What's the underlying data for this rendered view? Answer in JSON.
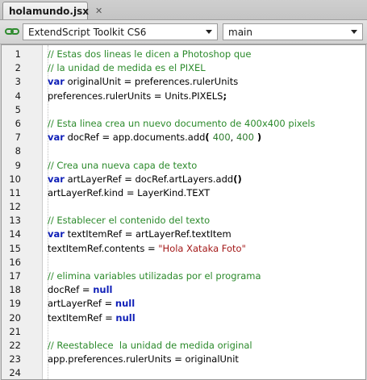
{
  "tab": {
    "title": "holamundo.jsx",
    "close_symbol": "✕"
  },
  "toolbar": {
    "target_app": "ExtendScript Toolkit CS6",
    "engine": "main",
    "link_icon": "link-chain-icon"
  },
  "colors": {
    "comment": "#2b8a2b",
    "keyword": "#1020b8",
    "string": "#a31818",
    "number": "#2c7a2c"
  },
  "editor": {
    "lines": [
      {
        "n": "1",
        "tokens": [
          {
            "t": "// Estas dos lineas le dicen a Photoshop que",
            "k": "comment"
          }
        ]
      },
      {
        "n": "2",
        "tokens": [
          {
            "t": "// la unidad de medida es el PIXEL",
            "k": "comment"
          }
        ]
      },
      {
        "n": "3",
        "tokens": [
          {
            "t": "var",
            "k": "keyword"
          },
          {
            "t": " originalUnit = preferences.rulerUnits",
            "k": "ident"
          }
        ]
      },
      {
        "n": "4",
        "tokens": [
          {
            "t": "preferences.rulerUnits = Units.PIXELS",
            "k": "ident"
          },
          {
            "t": ";",
            "k": "bold"
          }
        ]
      },
      {
        "n": "5",
        "tokens": []
      },
      {
        "n": "6",
        "tokens": [
          {
            "t": "// Esta linea crea un nuevo documento de 400x400 pixels",
            "k": "comment"
          }
        ]
      },
      {
        "n": "7",
        "tokens": [
          {
            "t": "var",
            "k": "keyword"
          },
          {
            "t": " docRef = app.documents.add",
            "k": "ident"
          },
          {
            "t": "( ",
            "k": "bold"
          },
          {
            "t": "400",
            "k": "number"
          },
          {
            "t": ", ",
            "k": "ident"
          },
          {
            "t": "400",
            "k": "number"
          },
          {
            "t": " )",
            "k": "bold"
          }
        ]
      },
      {
        "n": "8",
        "tokens": []
      },
      {
        "n": "9",
        "tokens": [
          {
            "t": "// Crea una nueva capa de texto",
            "k": "comment"
          }
        ]
      },
      {
        "n": "10",
        "tokens": [
          {
            "t": "var",
            "k": "keyword"
          },
          {
            "t": " artLayerRef = docRef.artLayers.add",
            "k": "ident"
          },
          {
            "t": "()",
            "k": "bold"
          }
        ]
      },
      {
        "n": "11",
        "tokens": [
          {
            "t": "artLayerRef.kind = LayerKind.TEXT",
            "k": "ident"
          }
        ]
      },
      {
        "n": "12",
        "tokens": []
      },
      {
        "n": "13",
        "tokens": [
          {
            "t": "// Establecer el contenido del texto",
            "k": "comment"
          }
        ]
      },
      {
        "n": "14",
        "tokens": [
          {
            "t": "var",
            "k": "keyword"
          },
          {
            "t": " textItemRef = artLayerRef.textItem",
            "k": "ident"
          }
        ]
      },
      {
        "n": "15",
        "tokens": [
          {
            "t": "textItemRef.contents = ",
            "k": "ident"
          },
          {
            "t": "\"Hola Xataka Foto\"",
            "k": "string"
          }
        ]
      },
      {
        "n": "16",
        "tokens": []
      },
      {
        "n": "17",
        "tokens": [
          {
            "t": "// elimina variables utilizadas por el programa",
            "k": "comment"
          }
        ]
      },
      {
        "n": "18",
        "tokens": [
          {
            "t": "docRef = ",
            "k": "ident"
          },
          {
            "t": "null",
            "k": "keyword"
          }
        ]
      },
      {
        "n": "19",
        "tokens": [
          {
            "t": "artLayerRef = ",
            "k": "ident"
          },
          {
            "t": "null",
            "k": "keyword"
          }
        ]
      },
      {
        "n": "20",
        "tokens": [
          {
            "t": "textItemRef = ",
            "k": "ident"
          },
          {
            "t": "null",
            "k": "keyword"
          }
        ]
      },
      {
        "n": "21",
        "tokens": []
      },
      {
        "n": "22",
        "tokens": [
          {
            "t": "// Reestablece  la unidad de medida original",
            "k": "comment"
          }
        ]
      },
      {
        "n": "23",
        "tokens": [
          {
            "t": "app.preferences.rulerUnits = originalUnit",
            "k": "ident"
          }
        ]
      },
      {
        "n": "24",
        "tokens": []
      }
    ]
  }
}
